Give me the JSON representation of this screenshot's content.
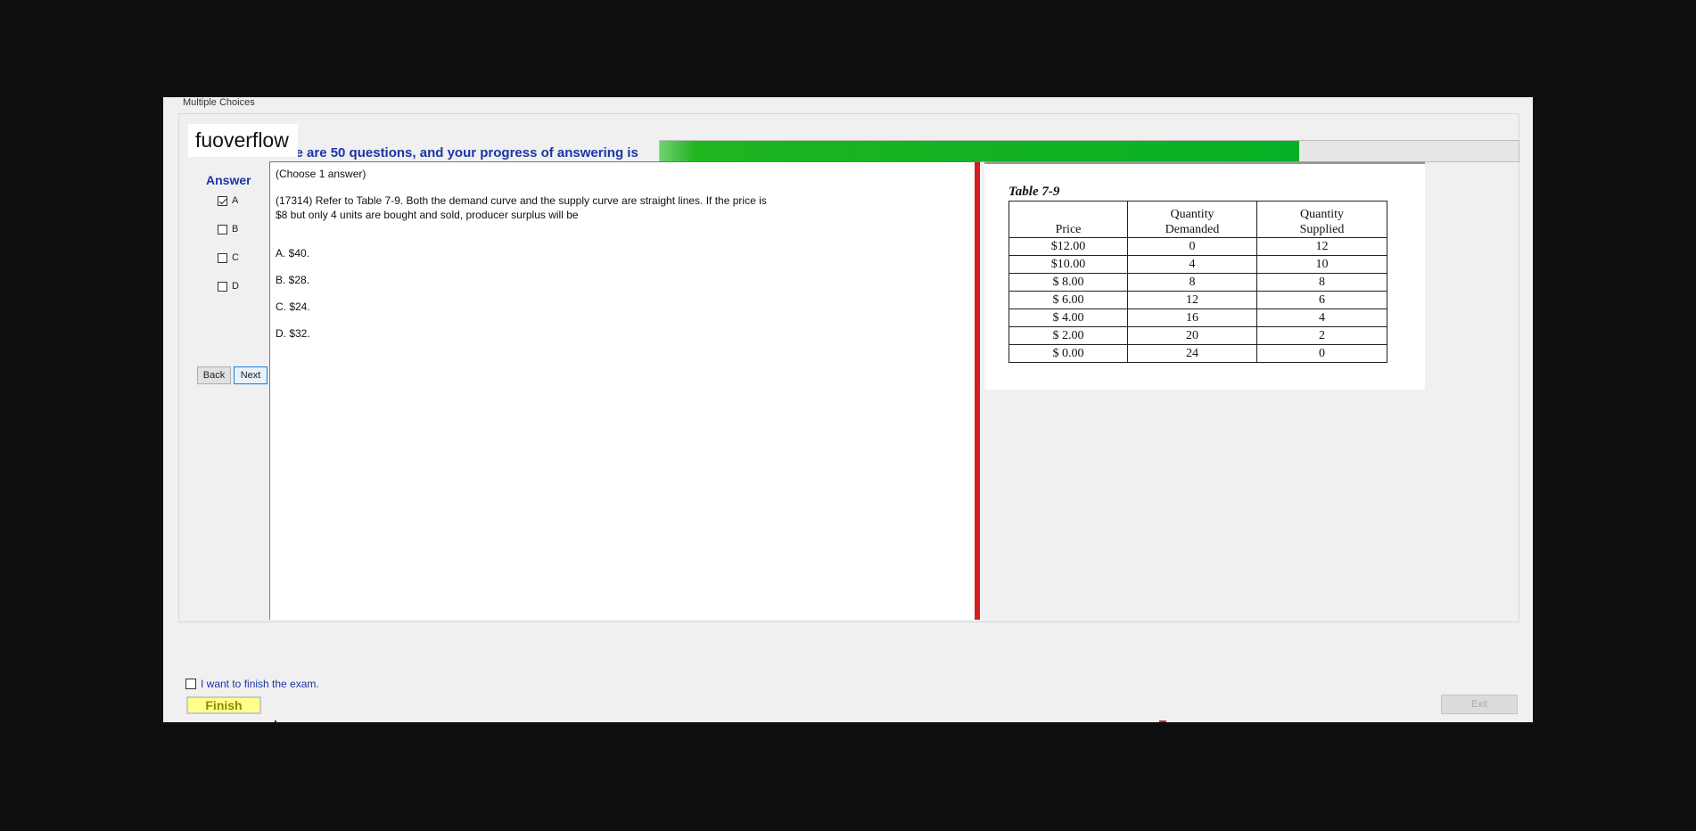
{
  "app": {
    "tab_label": "Multiple Choices",
    "watermark": "fuoverflow",
    "progress_text": "There are 50 questions, and your progress of answering is",
    "progress_fraction": 0.745
  },
  "answer": {
    "heading": "Answer",
    "options": [
      {
        "label": "A",
        "checked": true
      },
      {
        "label": "B",
        "checked": false
      },
      {
        "label": "C",
        "checked": false
      },
      {
        "label": "D",
        "checked": false
      }
    ]
  },
  "nav": {
    "back_label": "Back",
    "next_label": "Next"
  },
  "question": {
    "instruction": "(Choose 1 answer)",
    "line1": "(17314)  Refer to Table 7-9. Both the demand curve and the supply curve are straight lines.  If the price is",
    "line2": "$8 but only 4 units are bought and sold, producer surplus will be",
    "choices": [
      "A.  $40.",
      "B.  $28.",
      "C.  $24.",
      "D.  $32."
    ]
  },
  "table": {
    "title": "Table 7-9",
    "headers": {
      "price": "Price",
      "demanded_top": "Quantity",
      "demanded_bottom": "Demanded",
      "supplied_top": "Quantity",
      "supplied_bottom": "Supplied"
    },
    "rows": [
      {
        "price": "$12.00",
        "demanded": "0",
        "supplied": "12"
      },
      {
        "price": "$10.00",
        "demanded": "4",
        "supplied": "10"
      },
      {
        "price": "$ 8.00",
        "demanded": "8",
        "supplied": "8"
      },
      {
        "price": "$ 6.00",
        "demanded": "12",
        "supplied": "6"
      },
      {
        "price": "$ 4.00",
        "demanded": "16",
        "supplied": "4"
      },
      {
        "price": "$ 2.00",
        "demanded": "20",
        "supplied": "2"
      },
      {
        "price": "$ 0.00",
        "demanded": "24",
        "supplied": "0"
      }
    ]
  },
  "footer": {
    "finish_checkbox_label": "I want to finish the exam.",
    "finish_label": "Finish",
    "exit_label": "Exit"
  },
  "colors": {
    "accent_blue": "#1b36a6",
    "progress_green": "#06b025",
    "divider_red": "#d21e1e",
    "finish_yellow": "#ffff8a"
  }
}
